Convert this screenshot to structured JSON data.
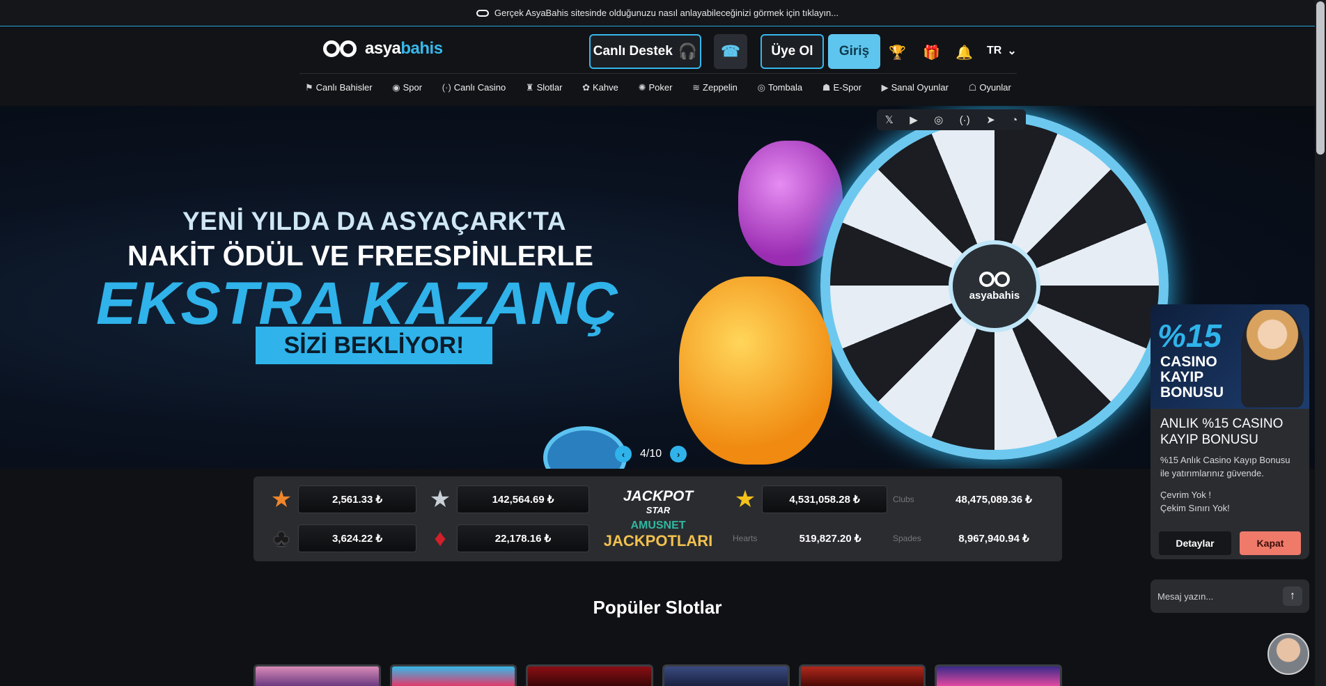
{
  "topbar": {
    "text": "Gerçek AsyaBahis sitesinde olduğunuzu nasıl anlayabileceğinizi görmek için tıklayın..."
  },
  "header": {
    "logo_a": "asya",
    "logo_b": "bahis",
    "support_label": "Canlı Destek",
    "register_label": "Üye Ol",
    "login_label": "Giriş",
    "lang": "TR",
    "icons": [
      "trophy-icon",
      "gift-icon",
      "bell-icon"
    ]
  },
  "nav": {
    "items": [
      {
        "label": "Canlı Bahisler",
        "icon": "⚑"
      },
      {
        "label": "Spor",
        "icon": "◉"
      },
      {
        "label": "Canlı Casino",
        "icon": "((·))"
      },
      {
        "label": "Slotlar",
        "icon": "♜"
      },
      {
        "label": "Kahve",
        "icon": "✿"
      },
      {
        "label": "Poker",
        "icon": "✺"
      },
      {
        "label": "Zeppelin",
        "icon": "≋"
      },
      {
        "label": "Tombala",
        "icon": "◎"
      },
      {
        "label": "E-Spor",
        "icon": "☗"
      },
      {
        "label": "Sanal Oyunlar",
        "icon": "▶"
      },
      {
        "label": "Oyunlar",
        "icon": "☖"
      }
    ]
  },
  "banner": {
    "line1": "YENİ YILDA DA ASYAÇARK'TA",
    "line2": "NAKİT ÖDÜL VE FREESPİNLERLE",
    "line3": "EKSTRA KAZANÇ",
    "line4": "SİZİ BEKLİYOR!",
    "hub_text": "asyabahis",
    "social": [
      "x-icon",
      "youtube-icon",
      "instagram-icon",
      "broadcast-icon",
      "telegram-icon",
      "speedometer-icon"
    ],
    "slide_counter": "4/10",
    "prev": "‹",
    "next": "›"
  },
  "jackpot": {
    "values": {
      "bronze_star": "2,561.33 ₺",
      "silver_star": "142,564.69 ₺",
      "gold_star": "4,531,058.28 ₺",
      "clubs": "3,624.22 ₺",
      "diamonds": "22,178.16 ₺",
      "hearts": "519,827.20 ₺",
      "spades": "8,967,940.94 ₺",
      "top_right": "48,475,089.36 ₺"
    },
    "broken_labels": {
      "top_right": "Clubs",
      "hearts": "Hearts",
      "spades": "Spades"
    },
    "logo_l1": "JACKPOT",
    "logo_l2": "STAR",
    "logo_l3": "AMUSNET",
    "logo_l4": "JACKPOTLARI"
  },
  "section_title": "Popüler Slotlar",
  "popup": {
    "pct": "%15",
    "img_line1": "CASINO",
    "img_line2": "KAYIP",
    "img_line3": "BONUSU",
    "title": "ANLIK %15 CASINO KAYIP BONUSU",
    "desc": "%15 Anlık Casino Kayıp Bonusu ile yatırımlarınız güvende.",
    "note1": "Çevrim Yok !",
    "note2": "Çekim Sınırı Yok!",
    "details_label": "Detaylar",
    "close_label": "Kapat"
  },
  "chat": {
    "placeholder": "Mesaj yazın..."
  },
  "colors": {
    "accent": "#2fb3ea",
    "close_btn": "#f07a6a"
  }
}
